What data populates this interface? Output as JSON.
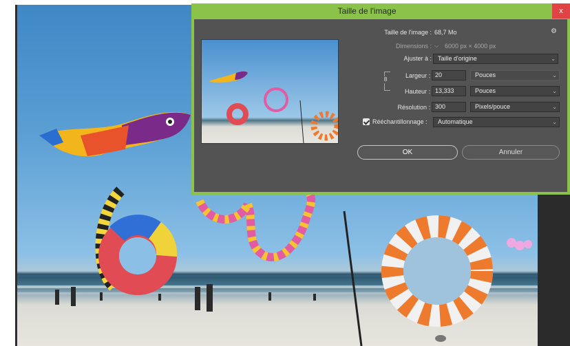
{
  "dialog": {
    "title": "Taille de l'image",
    "close": "x",
    "image_size_label": "Taille de l'image :",
    "image_size_value": "68,7 Mo",
    "dimensions_label": "Dimensions :",
    "dimensions_value": "6000 px  ×  4000 px",
    "fit_to_label": "Ajuster à :",
    "fit_to_value": "Taille d'origine",
    "width_label": "Largeur :",
    "width_value": "20",
    "width_unit": "Pouces",
    "height_label": "Hauteur :",
    "height_value": "13,333",
    "height_unit": "Pouces",
    "resolution_label": "Résolution :",
    "resolution_value": "300",
    "resolution_unit": "Pixels/pouce",
    "resample_label": "Rééchantillonnage :",
    "resample_value": "Automatique",
    "ok_label": "OK",
    "cancel_label": "Annuler"
  },
  "colors": {
    "accent": "#8bc34a",
    "dialog_bg": "#535353",
    "close_red": "#e04343"
  },
  "icons": {
    "gear": "gear-icon",
    "link": "chain-link-icon",
    "chevron": "chevron-down-icon"
  }
}
